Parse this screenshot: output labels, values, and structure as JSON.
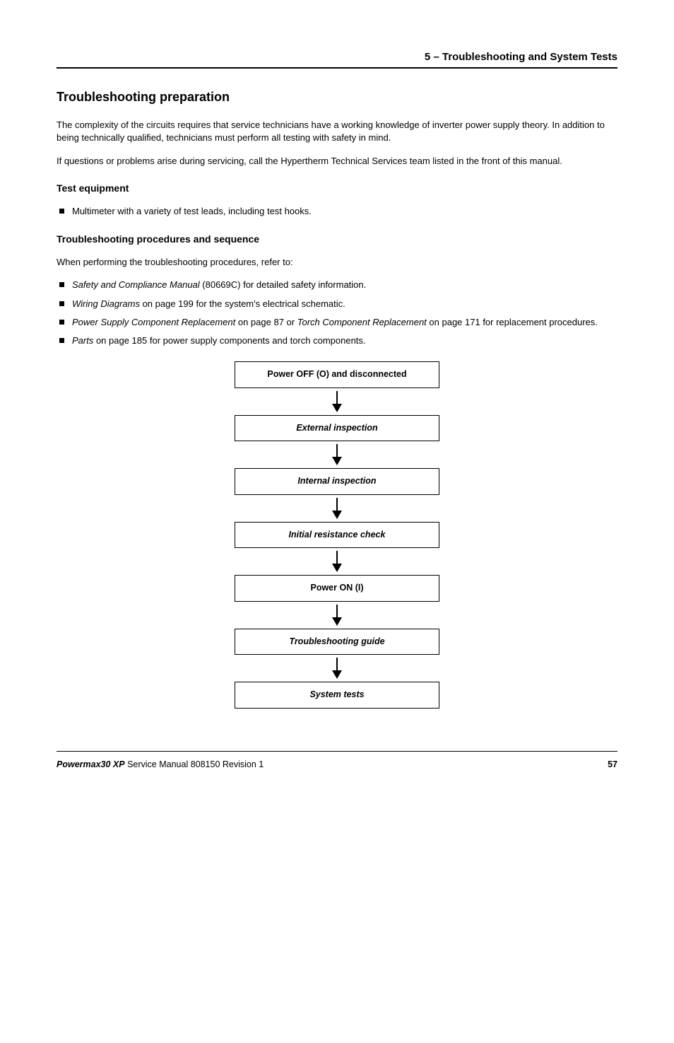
{
  "header": {
    "chapter_label": "5 – Troubleshooting and System Tests"
  },
  "section_heading": "Troubleshooting preparation",
  "para1": "The complexity of the circuits requires that service technicians have a working knowledge of inverter power supply theory. In addition to being technically qualified, technicians must perform all testing with safety in mind.",
  "para2": "If questions or problems arise during servicing, call the Hypertherm Technical Services team listed in the front of this manual.",
  "test_equipment": {
    "heading": "Test equipment",
    "items": [
      "Multimeter with a variety of test leads, including test hooks."
    ]
  },
  "procedures": {
    "heading": "Troubleshooting procedures and sequence",
    "lead": "When performing the troubleshooting procedures, refer to:",
    "items": [
      {
        "italic": "Safety and Compliance Manual",
        "after": " (80669C) for detailed safety information."
      },
      {
        "italic": "Wiring Diagrams",
        "after": " on page 199 for the system's electrical schematic."
      },
      {
        "italic": "Power Supply Component Replacement",
        "mid": " on page 87 or ",
        "italic2": "Torch Component Replacement",
        "after": " on page 171 for replacement procedures."
      },
      {
        "italic": "Parts",
        "after": " on page 185 for power supply components and torch components."
      }
    ]
  },
  "flow": {
    "boxes": [
      {
        "style": "bold",
        "text": "Power OFF (O) and disconnected"
      },
      {
        "style": "bolditalic",
        "text": "External inspection"
      },
      {
        "style": "bolditalic",
        "text": "Internal inspection"
      },
      {
        "style": "bolditalic",
        "text": "Initial resistance check"
      },
      {
        "style": "bold",
        "text": "Power ON (I)"
      },
      {
        "style": "bolditalic",
        "text": "Troubleshooting guide"
      },
      {
        "style": "bolditalic",
        "text": "System tests"
      }
    ]
  },
  "footer": {
    "product": "Powermax30 XP",
    "doc": "  Service Manual  808150  Revision 1",
    "page": "57"
  }
}
